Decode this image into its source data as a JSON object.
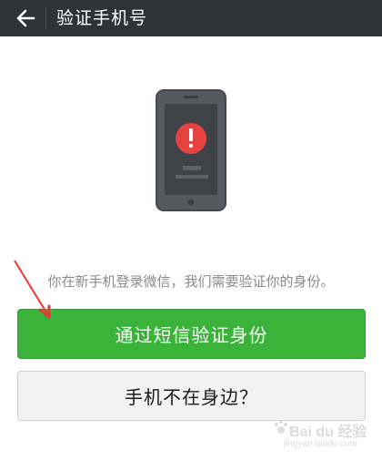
{
  "header": {
    "back_icon": "back-arrow-icon",
    "title": "验证手机号"
  },
  "illustration": {
    "icon": "phone-alert-icon",
    "alert_symbol": "!"
  },
  "message": "你在新手机登录微信，我们需要验证你的身份。",
  "buttons": {
    "primary": "通过短信验证身份",
    "secondary": "手机不在身边？"
  },
  "watermark": {
    "logo": "Bai du 经验",
    "url": "jingyan.baidu.com"
  },
  "colors": {
    "topbar": "#2f3236",
    "primary": "#3bb33a",
    "alert": "#e64340",
    "annotation": "#e53935"
  }
}
